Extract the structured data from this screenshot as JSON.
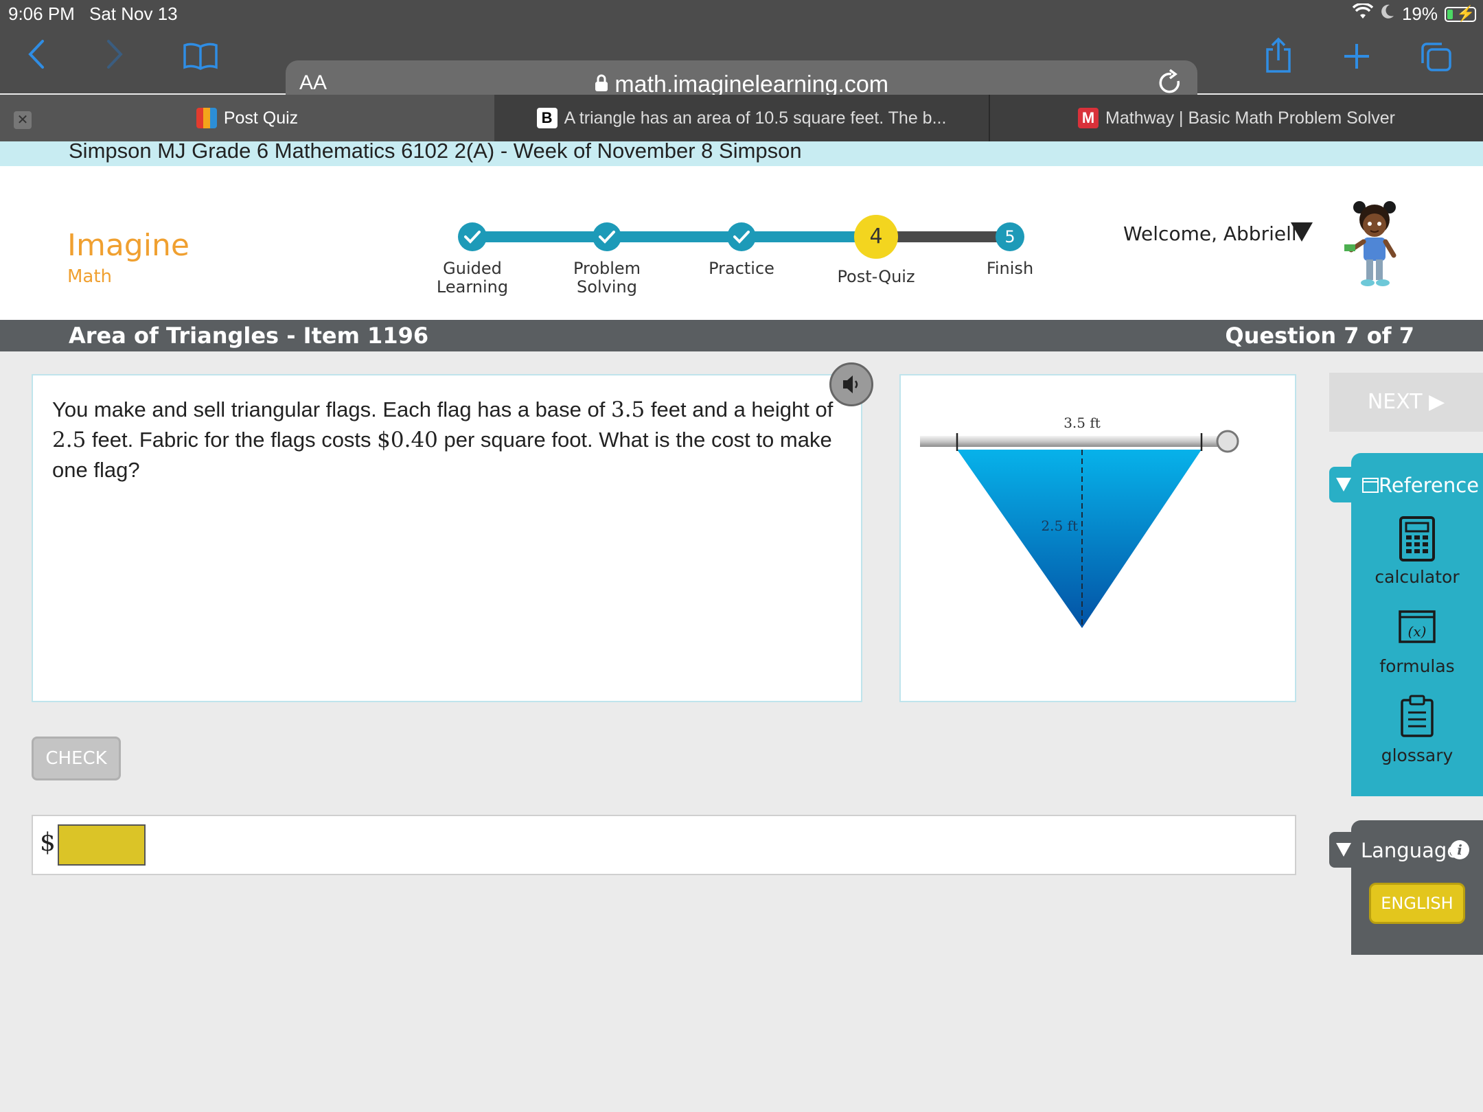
{
  "statusbar": {
    "time": "9:06 PM",
    "date": "Sat Nov 13",
    "battery": "19%"
  },
  "browser": {
    "text_size": "AA",
    "url": "math.imaginelearning.com",
    "tabs": [
      {
        "label": "Post Quiz",
        "active": true
      },
      {
        "label": "A triangle has an area of 10.5 square feet. The b...",
        "active": false
      },
      {
        "label": "Mathway | Basic Math Problem Solver",
        "active": false
      }
    ],
    "brainly_favicon": "B",
    "mathway_favicon": "M",
    "accent": "#2f8de4"
  },
  "course": {
    "title": "Simpson MJ Grade 6 Mathematics 6102 2(A) - Week of November 8 Simpson"
  },
  "logo": {
    "line1": "Imagine",
    "line2": "Math"
  },
  "progress": {
    "steps": [
      {
        "label_l1": "Guided",
        "label_l2": "Learning",
        "state": "done"
      },
      {
        "label_l1": "Problem",
        "label_l2": "Solving",
        "state": "done"
      },
      {
        "label_l1": "Practice",
        "label_l2": "",
        "state": "done"
      },
      {
        "number": "4",
        "label_l1": "Post-Quiz",
        "label_l2": "",
        "state": "current"
      },
      {
        "number": "5",
        "label_l1": "Finish",
        "label_l2": "",
        "state": "upcoming"
      }
    ],
    "done_color": "#1d9ab8",
    "current_color": "#f3d51f"
  },
  "user": {
    "welcome": "Welcome, Abbriell"
  },
  "lesson": {
    "title": "Area of Triangles - Item 1196",
    "question_count": "Question 7 of 7"
  },
  "question": {
    "t1": "You make and sell triangular flags. Each flag has a base of ",
    "n1": "3.5",
    "t2": " feet and a height of ",
    "n2": "2.5",
    "t3": " feet. Fabric for the flags costs ",
    "n3": "$0.40",
    "t4": " per square foot. What is the cost to make one flag?"
  },
  "figure": {
    "base_label": "3.5 ft",
    "height_label": "2.5 ft"
  },
  "buttons": {
    "check": "CHECK",
    "next": "NEXT ▶",
    "english": "ENGLISH"
  },
  "answer": {
    "prefix": "$",
    "value": ""
  },
  "reference": {
    "title": "Reference",
    "items": [
      {
        "label": "calculator",
        "icon": "calculator-icon"
      },
      {
        "label": "formulas",
        "icon": "formulas-icon"
      },
      {
        "label": "glossary",
        "icon": "glossary-icon"
      }
    ],
    "formula_glyph": "(x)"
  },
  "language": {
    "title": "Language",
    "info": "i"
  }
}
